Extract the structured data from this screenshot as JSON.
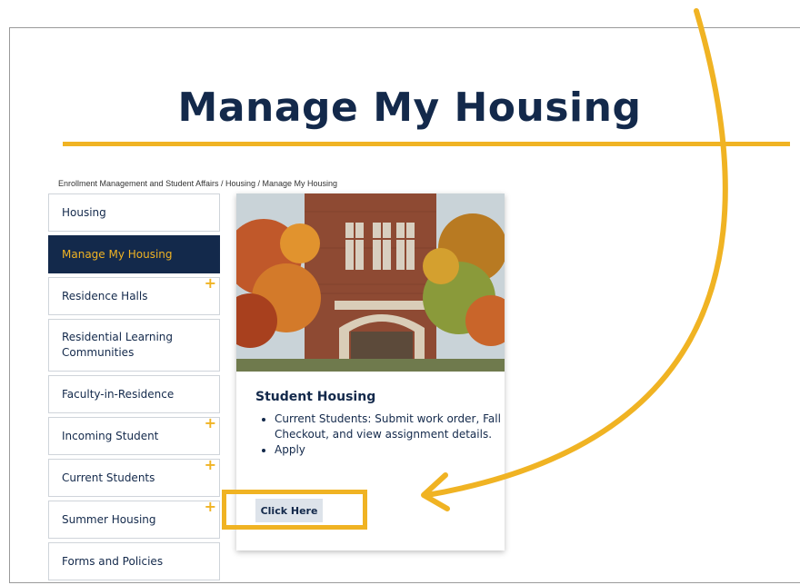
{
  "page": {
    "title": "Manage My Housing"
  },
  "breadcrumb": {
    "items": [
      "Enrollment Management and Student Affairs",
      "Housing",
      "Manage My Housing"
    ],
    "separator": " / "
  },
  "sidebar": {
    "items": [
      {
        "label": "Housing",
        "expandable": false,
        "active": false
      },
      {
        "label": "Manage My Housing",
        "expandable": false,
        "active": true
      },
      {
        "label": "Residence Halls",
        "expandable": true,
        "active": false
      },
      {
        "label": "Residential Learning Communities",
        "expandable": false,
        "active": false
      },
      {
        "label": "Faculty-in-Residence",
        "expandable": false,
        "active": false
      },
      {
        "label": "Incoming Student",
        "expandable": true,
        "active": false
      },
      {
        "label": "Current Students",
        "expandable": true,
        "active": false
      },
      {
        "label": "Summer Housing",
        "expandable": true,
        "active": false
      },
      {
        "label": "Forms and Policies",
        "expandable": false,
        "active": false
      }
    ],
    "expand_glyph": "+"
  },
  "card": {
    "heading": "Student Housing",
    "bullets": [
      "Current Students: Submit work order, Fall Checkout, and view assignment details.",
      "Apply"
    ],
    "button_label": "Click Here",
    "image_icon": "campus-building-photo"
  },
  "annotation": {
    "highlight_color": "#f0b323",
    "arrow_icon": "curved-arrow-icon"
  },
  "colors": {
    "navy": "#13294b",
    "gold": "#f0b323"
  }
}
